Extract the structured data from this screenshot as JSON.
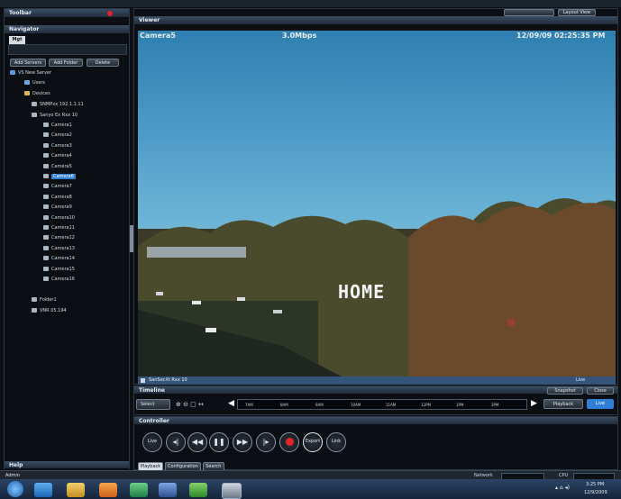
{
  "sidebar": {
    "title": "Toolbar",
    "navigator": "Navigator",
    "tab": "Mgt",
    "buttons": [
      "Add Servers",
      "Add Folder",
      "Delete"
    ],
    "tree": {
      "root": "VS New Server",
      "users": "Users",
      "devices": "Devices",
      "device1": "SNMPxx 192.1.1.11",
      "device2": "Sanyo Ex Rxx 10",
      "cameras": [
        "Camera1",
        "Camera2",
        "Camera3",
        "Camera4",
        "Camera5",
        "Camera6",
        "Camera7",
        "Camera8",
        "Camera9",
        "Camera10",
        "Camera11",
        "Camera12",
        "Camera13",
        "Camera14",
        "Camera15",
        "Camera16"
      ],
      "selected_index": 5,
      "extra": [
        "Folder1",
        "VNR 05.194"
      ]
    },
    "help": "Help"
  },
  "viewer": {
    "title": "Viewer",
    "layout_btn": "Layout View",
    "camera_name": "Camera5",
    "bitrate": "3.0Mbps",
    "timestamp": "12/09/09 02:25:35 PM",
    "overlay_text": "HOME",
    "status_device": "SanSecXt Rxx 10",
    "status_live": "Live"
  },
  "timeline": {
    "title": "Timeline",
    "snapshot": "Snapshot",
    "close": "Close",
    "select": "Select",
    "ticks": [
      "7AM",
      "8AM",
      "9AM",
      "10AM",
      "11AM",
      "12PM",
      "1PM",
      "2PM"
    ],
    "playback": "Playback",
    "live": "Live"
  },
  "controller": {
    "title": "Controller",
    "controls": [
      "Live",
      "step-back",
      "rewind",
      "pause",
      "fast-forward",
      "step-forward",
      "record",
      "Export",
      "Link"
    ],
    "tabs": [
      "Playback",
      "Configuration",
      "Search"
    ]
  },
  "statusbar": {
    "left": "Admin",
    "network": "Network",
    "cpu": "CPU"
  },
  "taskbar": {
    "clock": "3:25 PM",
    "date": "12/9/2009"
  },
  "colors": {
    "sky": "#3f8fc0",
    "selection": "#2f7fd6",
    "record": "#e0242a"
  }
}
